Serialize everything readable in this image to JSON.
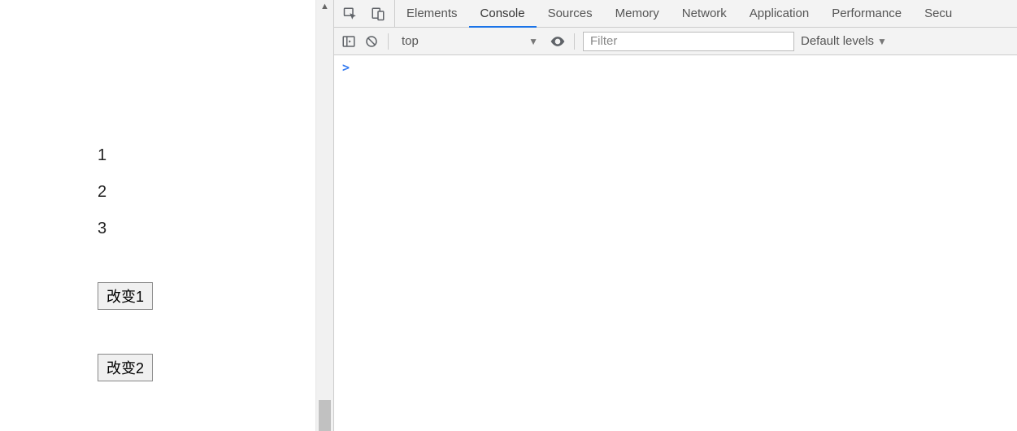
{
  "page": {
    "items": [
      "1",
      "2",
      "3"
    ],
    "buttons": [
      "改变1",
      "改变2"
    ]
  },
  "devtools": {
    "tabs": [
      "Elements",
      "Console",
      "Sources",
      "Memory",
      "Network",
      "Application",
      "Performance",
      "Secu"
    ],
    "active_tab": "Console",
    "toolbar": {
      "context": "top",
      "filter_placeholder": "Filter",
      "levels": "Default levels"
    },
    "console_prompt": ">"
  }
}
